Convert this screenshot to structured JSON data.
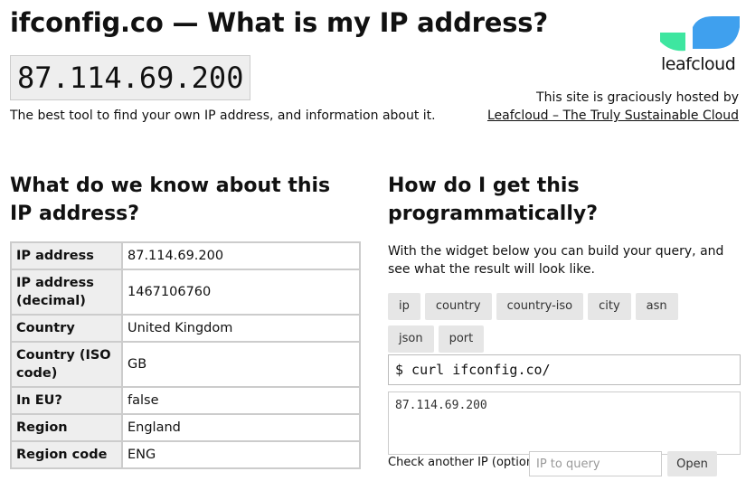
{
  "header": {
    "title": "ifconfig.co — What is my IP address?",
    "ip": "87.114.69.200",
    "tagline": "The best tool to find your own IP address, and information about it."
  },
  "host": {
    "logo_text": "leafcloud",
    "prefix": "This site is graciously hosted by",
    "link_text": "Leafcloud – The Truly Sustainable Cloud",
    "colors": {
      "leaf_green": "#3ee6a0",
      "leaf_blue": "#3fa0ee"
    }
  },
  "info": {
    "title": "What do we know about this IP address?",
    "rows": [
      {
        "key": "IP address",
        "value": "87.114.69.200"
      },
      {
        "key": "IP address (decimal)",
        "value": "1467106760"
      },
      {
        "key": "Country",
        "value": "United Kingdom"
      },
      {
        "key": "Country (ISO code)",
        "value": "GB"
      },
      {
        "key": "In EU?",
        "value": "false"
      },
      {
        "key": "Region",
        "value": "England"
      },
      {
        "key": "Region code",
        "value": "ENG"
      }
    ]
  },
  "programmatic": {
    "title": "How do I get this programmatically?",
    "description": "With the widget below you can build your query, and see what the result will look like.",
    "chips": [
      "ip",
      "country",
      "country-iso",
      "city",
      "asn",
      "json",
      "port"
    ],
    "command": "$ curl ifconfig.co/",
    "result": "87.114.69.200",
    "check_label": "Check another IP (optional)",
    "check_placeholder": "IP to query",
    "open_label": "Open"
  }
}
